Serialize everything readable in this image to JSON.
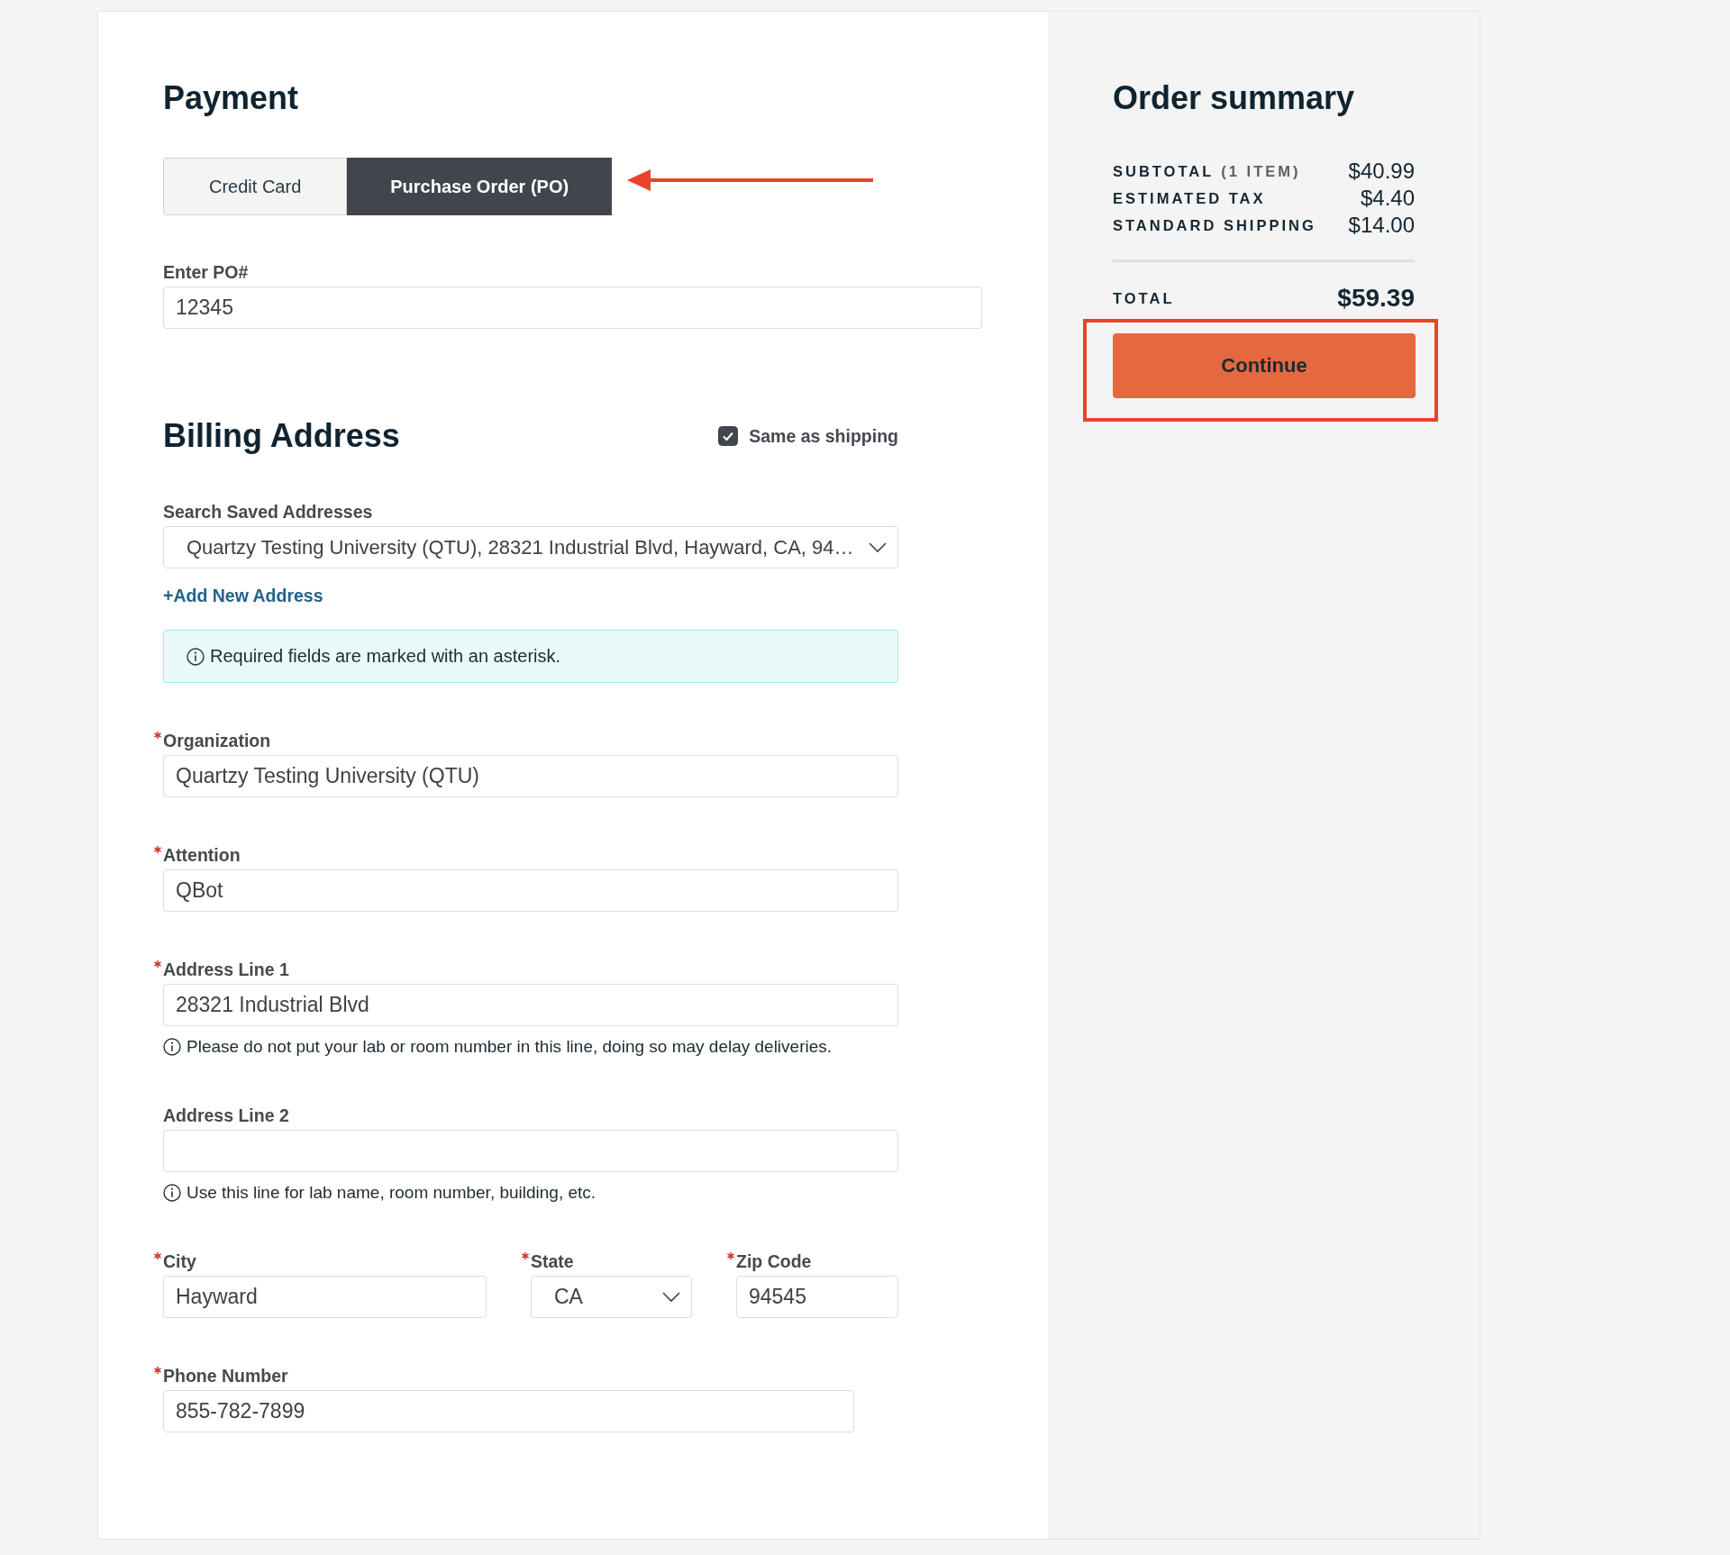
{
  "payment": {
    "title": "Payment",
    "tabs": [
      {
        "label": "Credit Card",
        "selected": false
      },
      {
        "label": "Purchase Order (PO)",
        "selected": true
      }
    ],
    "po_field": {
      "label": "Enter PO#",
      "value": "12345"
    }
  },
  "billing": {
    "title": "Billing Address",
    "same_as_shipping": {
      "label": "Same as shipping",
      "checked": true
    },
    "saved_addresses": {
      "label": "Search Saved Addresses",
      "value": "Quartzy Testing University (QTU), 28321 Industrial Blvd, Hayward, CA, 94…"
    },
    "add_address_link": "+Add New Address",
    "notice": "Required fields are marked with an asterisk.",
    "rows": [
      {
        "fields": [
          {
            "kind": "text",
            "label": "Organization",
            "required": true,
            "value": "Quartzy Testing University (QTU)"
          }
        ]
      },
      {
        "fields": [
          {
            "kind": "text",
            "label": "Attention",
            "required": true,
            "value": "QBot"
          }
        ]
      },
      {
        "fields": [
          {
            "kind": "text",
            "label": "Address Line 1",
            "required": true,
            "value": "28321 Industrial Blvd",
            "hint": "Please do not put your lab or room number in this line, doing so may delay deliveries."
          }
        ]
      },
      {
        "fields": [
          {
            "kind": "text",
            "label": "Address Line 2",
            "required": false,
            "hint": "Use this line for lab name, room number, building, etc."
          }
        ]
      },
      {
        "fields": [
          {
            "kind": "text",
            "label": "City",
            "required": true,
            "value": "Hayward"
          },
          {
            "kind": "select",
            "label": "State",
            "required": true,
            "value": "CA"
          },
          {
            "kind": "text",
            "label": "Zip Code",
            "required": true,
            "value": "94545"
          }
        ]
      },
      {
        "fields": [
          {
            "kind": "text",
            "label": "Phone Number",
            "required": true,
            "value": "855-782-7899"
          }
        ]
      }
    ]
  },
  "order_summary": {
    "title": "Order summary",
    "lines": [
      {
        "label": "SUBTOTAL",
        "note": "(1 ITEM)",
        "amount": "$40.99"
      },
      {
        "label": "ESTIMATED TAX",
        "amount": "$4.40"
      },
      {
        "label": "STANDARD SHIPPING",
        "amount": "$14.00"
      }
    ],
    "total": {
      "label": "TOTAL",
      "amount": "$59.39"
    },
    "continue_button": "Continue"
  }
}
